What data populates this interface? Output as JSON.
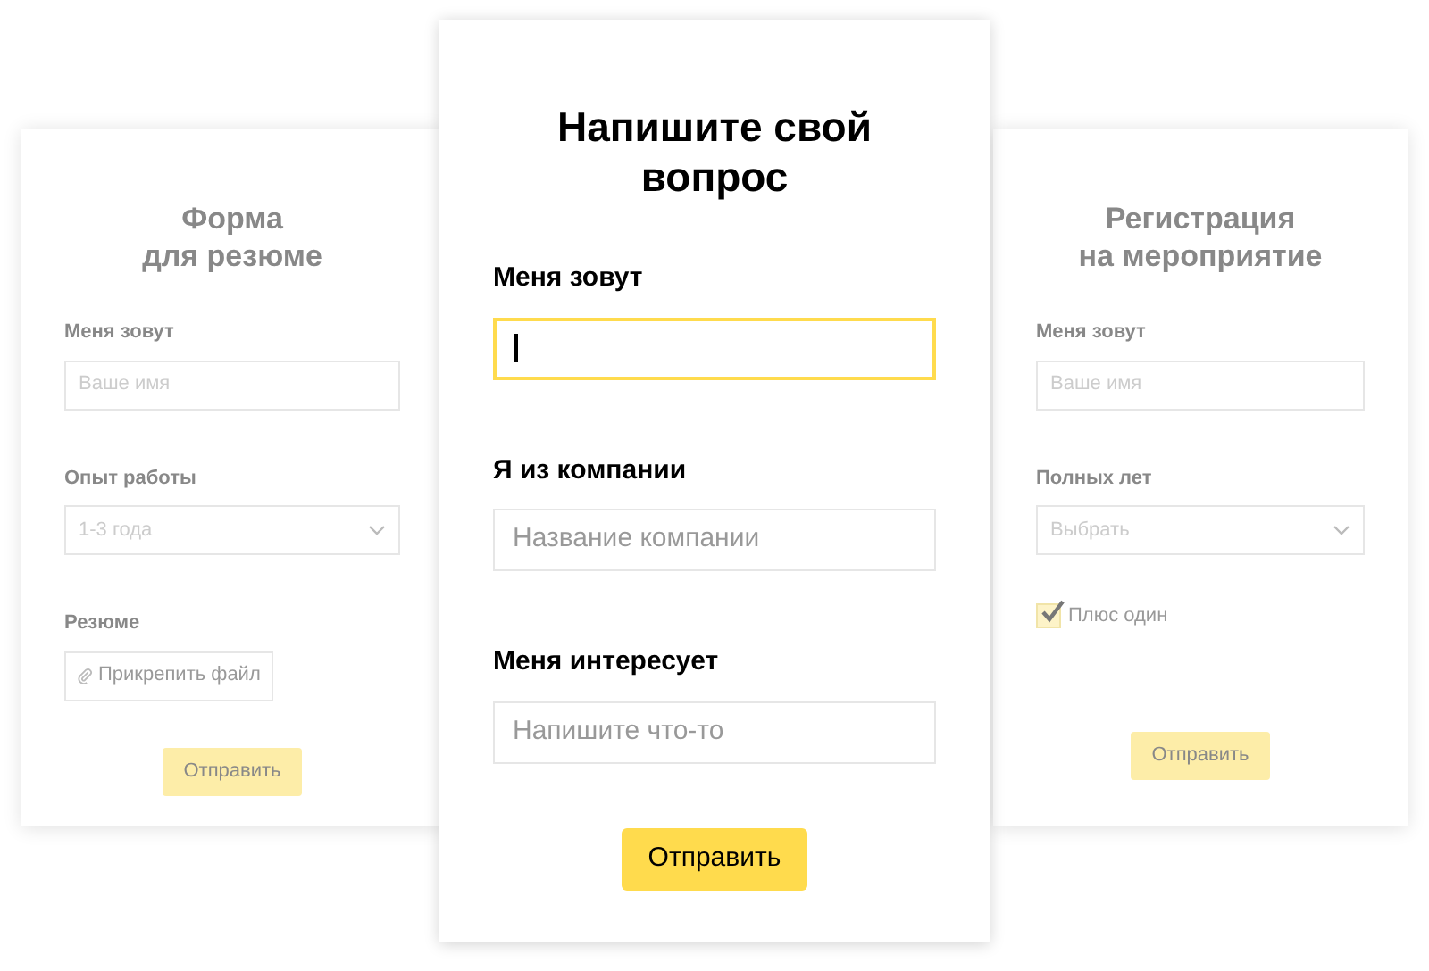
{
  "cards": [
    {
      "active": false,
      "title": "Форма\nдля резюме",
      "fields": [
        {
          "kind": "text",
          "label": "Меня зовут",
          "placeholder": "Ваше имя",
          "focused": false
        },
        {
          "kind": "select",
          "label": "Опыт работы",
          "value": "1-3 года"
        },
        {
          "kind": "file",
          "label": "Резюме",
          "button": "Прикрепить файл"
        }
      ],
      "submit": "Отправить"
    },
    {
      "active": true,
      "title": "Напишите свой\nвопрос",
      "fields": [
        {
          "kind": "text",
          "label": "Меня зовут",
          "focused": true
        },
        {
          "kind": "text",
          "label": "Я из компании",
          "placeholder": "Название компании",
          "focused": false
        },
        {
          "kind": "text",
          "label": "Меня интересует",
          "placeholder": "Напишите что-то",
          "focused": false
        }
      ],
      "submit": "Отправить"
    },
    {
      "active": false,
      "title": "Регистрация\nна мероприятие",
      "fields": [
        {
          "kind": "text",
          "label": "Меня зовут",
          "placeholder": "Ваше имя",
          "focused": false
        },
        {
          "kind": "select",
          "label": "Полных лет",
          "placeholder": "Выбрать"
        },
        {
          "kind": "checkbox",
          "label": "Плюс один",
          "checked": true
        }
      ],
      "submit": "Отправить"
    }
  ]
}
